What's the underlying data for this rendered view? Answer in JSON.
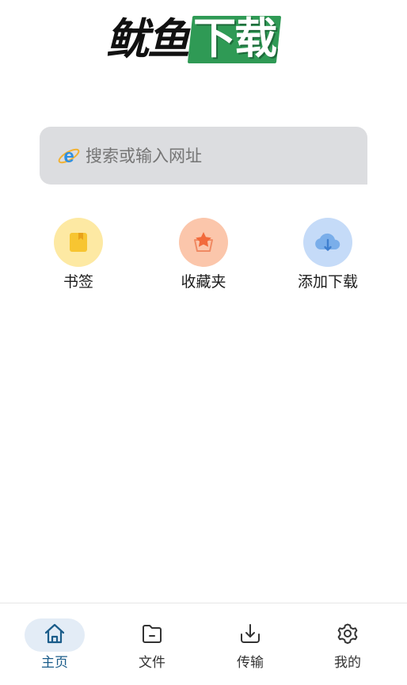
{
  "logo": {
    "text_dark": "鱿鱼",
    "text_green": "下载",
    "green_color": "#2f9a55"
  },
  "search": {
    "placeholder": "搜索或输入网址",
    "icon": "ie-browser-icon"
  },
  "quick_actions": [
    {
      "label": "书签",
      "icon": "bookmark-icon",
      "bg": "#fde9a3",
      "fg": "#f7c531"
    },
    {
      "label": "收藏夹",
      "icon": "star-basket-icon",
      "bg": "#fbc6ab",
      "fg": "#f26a3c"
    },
    {
      "label": "添加下载",
      "icon": "cloud-download-icon",
      "bg": "#c5dbf8",
      "fg": "#5e9be4"
    }
  ],
  "bottom_nav": [
    {
      "label": "主页",
      "icon": "home-icon",
      "active": true
    },
    {
      "label": "文件",
      "icon": "folder-icon",
      "active": false
    },
    {
      "label": "传输",
      "icon": "download-tray-icon",
      "active": false
    },
    {
      "label": "我的",
      "icon": "gear-icon",
      "active": false
    }
  ],
  "colors": {
    "active_nav": "#1a5c8a",
    "active_nav_bg": "#e3ecf6",
    "search_bg": "#dcdde0"
  }
}
